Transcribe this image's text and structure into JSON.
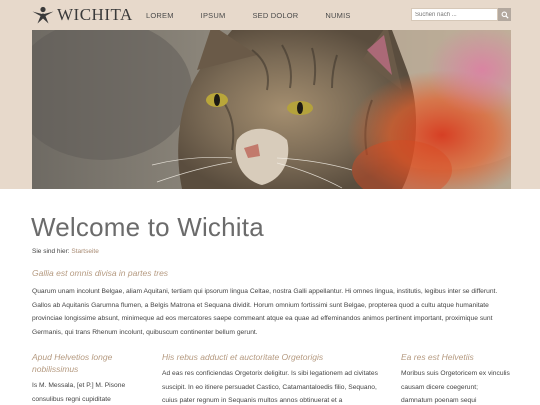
{
  "header": {
    "brand": "WICHITA",
    "nav": [
      "LOREM",
      "IPSUM",
      "SED DOLOR",
      "NUMIS"
    ],
    "search_placeholder": "Suchen nach ..."
  },
  "colors": {
    "header_bg": "#e7d9cb",
    "accent": "#b59a80",
    "link": "#a88b73"
  },
  "icons": {
    "logo": "person-star-logo-icon",
    "search": "search-icon"
  },
  "page": {
    "title": "Welcome to Wichita",
    "breadcrumb_label": "Sie sind hier:",
    "breadcrumb_link": "Startseite"
  },
  "intro": {
    "heading": "Gallia est omnis divisa in partes tres",
    "text": "Quarum unam incolunt Belgae, aliam Aquitani, tertiam qui ipsorum lingua Celtae, nostra Galli appellantur. Hi omnes lingua, institutis, legibus inter se differunt. Gallos ab Aquitanis Garumna flumen, a Belgis Matrona et Sequana dividit. Horum omnium fortissimi sunt Belgae, propterea quod a cultu atque humanitate provinciae longissime absunt, minimeque ad eos mercatores saepe commeant atque ea quae ad effeminandos animos pertinent important, proximique sunt Germanis, qui trans Rhenum incolunt, quibuscum continenter bellum gerunt."
  },
  "columns": [
    {
      "heading": "Apud Helvetios longe nobilissimus",
      "text": "Is M. Messala, [et P.] M. Pisone consulibus regni cupiditate"
    },
    {
      "heading": "His rebus adducti et auctoritate Orgetorigis",
      "text": "Ad eas res conficiendas Orgetorix deligitur. Is sibi legationem ad civitates suscipit. In eo itinere persuadet Castico, Catamantaloedis filio, Sequano, cuius pater regnum in Sequanis multos annos obtinuerat et a"
    },
    {
      "heading": "Ea res est Helvetiis",
      "text": "Moribus suis Orgetoricem ex vinculis causam dicere coegerunt; damnatum poenam sequi"
    }
  ]
}
